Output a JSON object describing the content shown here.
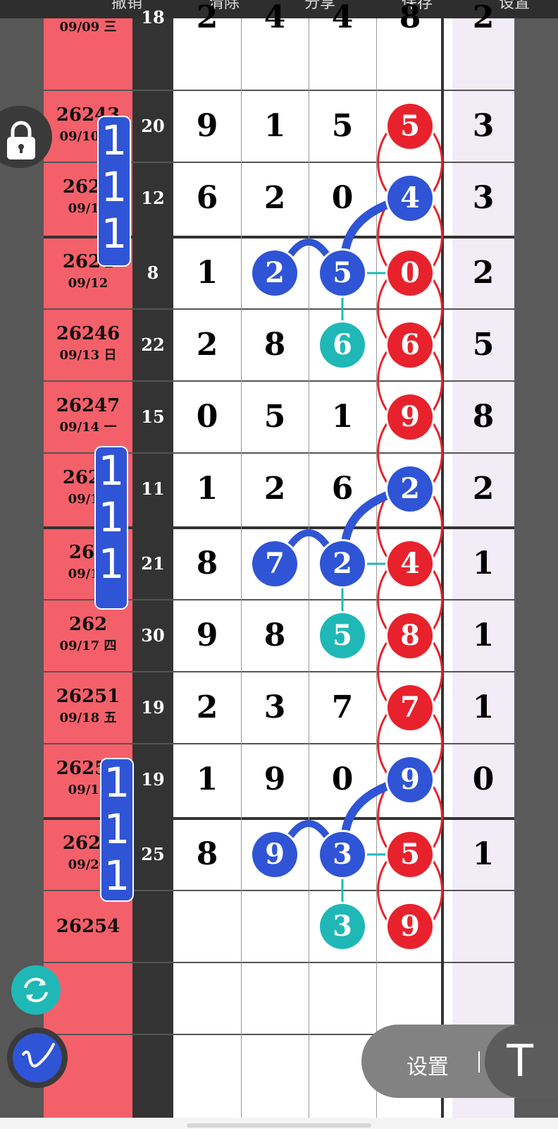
{
  "toolbar": [
    "撤销",
    "清除",
    "分享",
    "保存",
    "设置"
  ],
  "periods": [
    {
      "id": "",
      "date": "09/09 三"
    },
    {
      "id": "26243",
      "date": "09/10 四"
    },
    {
      "id": "2624",
      "date": "09/11"
    },
    {
      "id": "2624",
      "date": "09/12"
    },
    {
      "id": "26246",
      "date": "09/13 日"
    },
    {
      "id": "26247",
      "date": "09/14 一"
    },
    {
      "id": "2624",
      "date": "09/15"
    },
    {
      "id": "262",
      "date": "09/16"
    },
    {
      "id": "262",
      "date": "09/17 四"
    },
    {
      "id": "26251",
      "date": "09/18 五"
    },
    {
      "id": "26252",
      "date": "09/19"
    },
    {
      "id": "2625",
      "date": "09/20"
    },
    {
      "id": "26254",
      "date": ""
    }
  ],
  "sums": [
    "18",
    "20",
    "12",
    "8",
    "22",
    "15",
    "11",
    "21",
    "30",
    "19",
    "19",
    "25",
    ""
  ],
  "grid": [
    [
      "2",
      "4",
      "4",
      "8",
      "2"
    ],
    [
      "9",
      "1",
      "5",
      "5",
      "3"
    ],
    [
      "6",
      "2",
      "0",
      "4",
      "3"
    ],
    [
      "1",
      "2",
      "5",
      "0",
      "2"
    ],
    [
      "2",
      "8",
      "6",
      "6",
      "5"
    ],
    [
      "0",
      "5",
      "1",
      "9",
      "8"
    ],
    [
      "1",
      "2",
      "6",
      "2",
      "2"
    ],
    [
      "8",
      "7",
      "2",
      "4",
      "1"
    ],
    [
      "9",
      "8",
      "5",
      "8",
      "1"
    ],
    [
      "2",
      "3",
      "7",
      "7",
      "1"
    ],
    [
      "1",
      "9",
      "0",
      "9",
      "0"
    ],
    [
      "8",
      "9",
      "3",
      "5",
      "1"
    ],
    [
      "",
      "",
      "3",
      "9",
      ""
    ]
  ],
  "highlights": [
    {
      "row": 1,
      "col": 3,
      "color": "red"
    },
    {
      "row": 2,
      "col": 3,
      "color": "blue"
    },
    {
      "row": 3,
      "col": 1,
      "color": "blue"
    },
    {
      "row": 3,
      "col": 2,
      "color": "blue"
    },
    {
      "row": 3,
      "col": 3,
      "color": "red"
    },
    {
      "row": 4,
      "col": 2,
      "color": "teal"
    },
    {
      "row": 4,
      "col": 3,
      "color": "red"
    },
    {
      "row": 5,
      "col": 3,
      "color": "red"
    },
    {
      "row": 6,
      "col": 3,
      "color": "blue"
    },
    {
      "row": 7,
      "col": 1,
      "color": "blue"
    },
    {
      "row": 7,
      "col": 2,
      "color": "blue"
    },
    {
      "row": 7,
      "col": 3,
      "color": "red"
    },
    {
      "row": 8,
      "col": 2,
      "color": "teal"
    },
    {
      "row": 8,
      "col": 3,
      "color": "red"
    },
    {
      "row": 9,
      "col": 3,
      "color": "red"
    },
    {
      "row": 10,
      "col": 3,
      "color": "blue"
    },
    {
      "row": 11,
      "col": 1,
      "color": "blue"
    },
    {
      "row": 11,
      "col": 2,
      "color": "blue"
    },
    {
      "row": 11,
      "col": 3,
      "color": "red"
    },
    {
      "row": 12,
      "col": 2,
      "color": "teal"
    },
    {
      "row": 12,
      "col": 3,
      "color": "red"
    }
  ],
  "badges": [
    {
      "digits": [
        "1",
        "1",
        "1"
      ]
    },
    {
      "digits": [
        "1",
        "1",
        "1"
      ]
    },
    {
      "digits": [
        "1",
        "1",
        "1"
      ]
    }
  ],
  "controls": {
    "settings_label": "设置",
    "text_tool_label": "T",
    "lock_icon": "lock-icon",
    "refresh_icon": "refresh-icon",
    "pen_icon": "pen-icon"
  },
  "colors": {
    "red": "#e8222c",
    "blue": "#2f54d6",
    "teal": "#1fb8b6",
    "period_bg": "#f4606a"
  }
}
